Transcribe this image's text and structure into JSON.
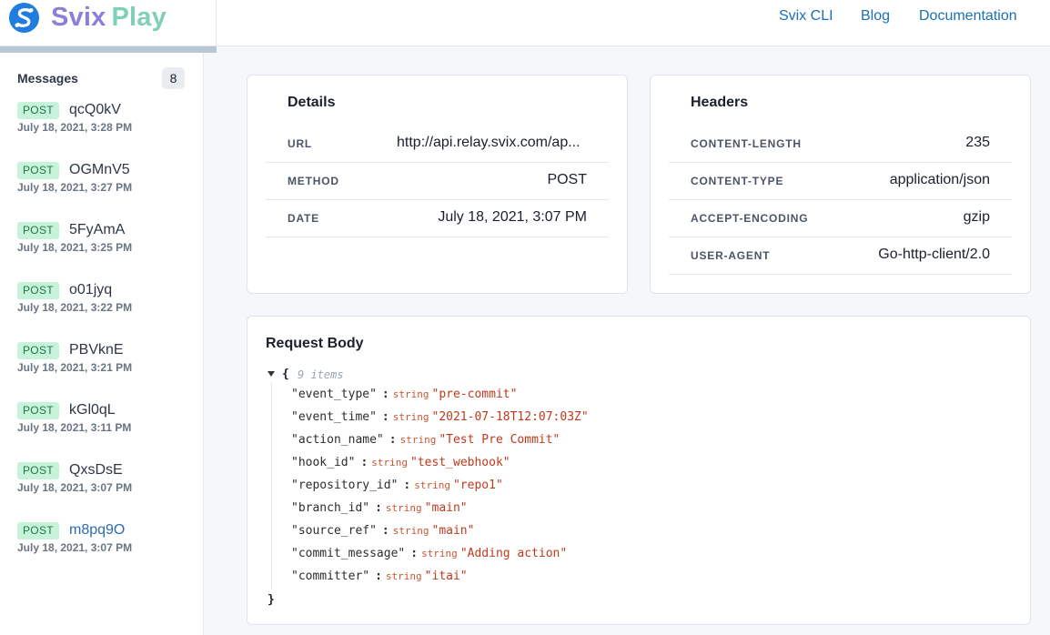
{
  "brand": {
    "name_part1": "Svix",
    "name_part2": "Play"
  },
  "nav": {
    "cli": "Svix CLI",
    "blog": "Blog",
    "docs": "Documentation"
  },
  "sidebar": {
    "heading": "Messages",
    "count": "8",
    "messages": [
      {
        "method": "POST",
        "id": "qcQ0kV",
        "time": "July 18, 2021, 3:28 PM"
      },
      {
        "method": "POST",
        "id": "OGMnV5",
        "time": "July 18, 2021, 3:27 PM"
      },
      {
        "method": "POST",
        "id": "5FyAmA",
        "time": "July 18, 2021, 3:25 PM"
      },
      {
        "method": "POST",
        "id": "o01jyq",
        "time": "July 18, 2021, 3:22 PM"
      },
      {
        "method": "POST",
        "id": "PBVknE",
        "time": "July 18, 2021, 3:21 PM"
      },
      {
        "method": "POST",
        "id": "kGl0qL",
        "time": "July 18, 2021, 3:11 PM"
      },
      {
        "method": "POST",
        "id": "QxsDsE",
        "time": "July 18, 2021, 3:07 PM"
      },
      {
        "method": "POST",
        "id": "m8pq9O",
        "time": "July 18, 2021, 3:07 PM"
      }
    ]
  },
  "details": {
    "title": "Details",
    "rows": [
      {
        "key": "URL",
        "value": "http://api.relay.svix.com/ap..."
      },
      {
        "key": "METHOD",
        "value": "POST"
      },
      {
        "key": "DATE",
        "value": "July 18, 2021, 3:07 PM"
      }
    ]
  },
  "headers": {
    "title": "Headers",
    "rows": [
      {
        "key": "CONTENT-LENGTH",
        "value": "235"
      },
      {
        "key": "CONTENT-TYPE",
        "value": "application/json"
      },
      {
        "key": "ACCEPT-ENCODING",
        "value": "gzip"
      },
      {
        "key": "USER-AGENT",
        "value": "Go-http-client/2.0"
      }
    ]
  },
  "body": {
    "title": "Request Body",
    "open": "{",
    "close": "}",
    "count_label": "9 items",
    "fields": [
      {
        "key": "\"event_type\"",
        "type": "string",
        "value": "\"pre-commit\""
      },
      {
        "key": "\"event_time\"",
        "type": "string",
        "value": "\"2021-07-18T12:07:03Z\""
      },
      {
        "key": "\"action_name\"",
        "type": "string",
        "value": "\"Test Pre Commit\""
      },
      {
        "key": "\"hook_id\"",
        "type": "string",
        "value": "\"test_webhook\""
      },
      {
        "key": "\"repository_id\"",
        "type": "string",
        "value": "\"repo1\""
      },
      {
        "key": "\"branch_id\"",
        "type": "string",
        "value": "\"main\""
      },
      {
        "key": "\"source_ref\"",
        "type": "string",
        "value": "\"main\""
      },
      {
        "key": "\"commit_message\"",
        "type": "string",
        "value": "\"Adding action\""
      },
      {
        "key": "\"committer\"",
        "type": "string",
        "value": "\"itai\""
      }
    ]
  },
  "colors": {
    "brand_svix": "#8b80d9",
    "brand_play": "#7fd0b5",
    "link": "#1a6fb8",
    "method_badge_bg": "#c6f3da",
    "method_badge_text": "#22774a",
    "json_value": "#c1391b"
  },
  "icons": {
    "logo": "svix-logo-icon",
    "expand": "caret-down-icon"
  }
}
